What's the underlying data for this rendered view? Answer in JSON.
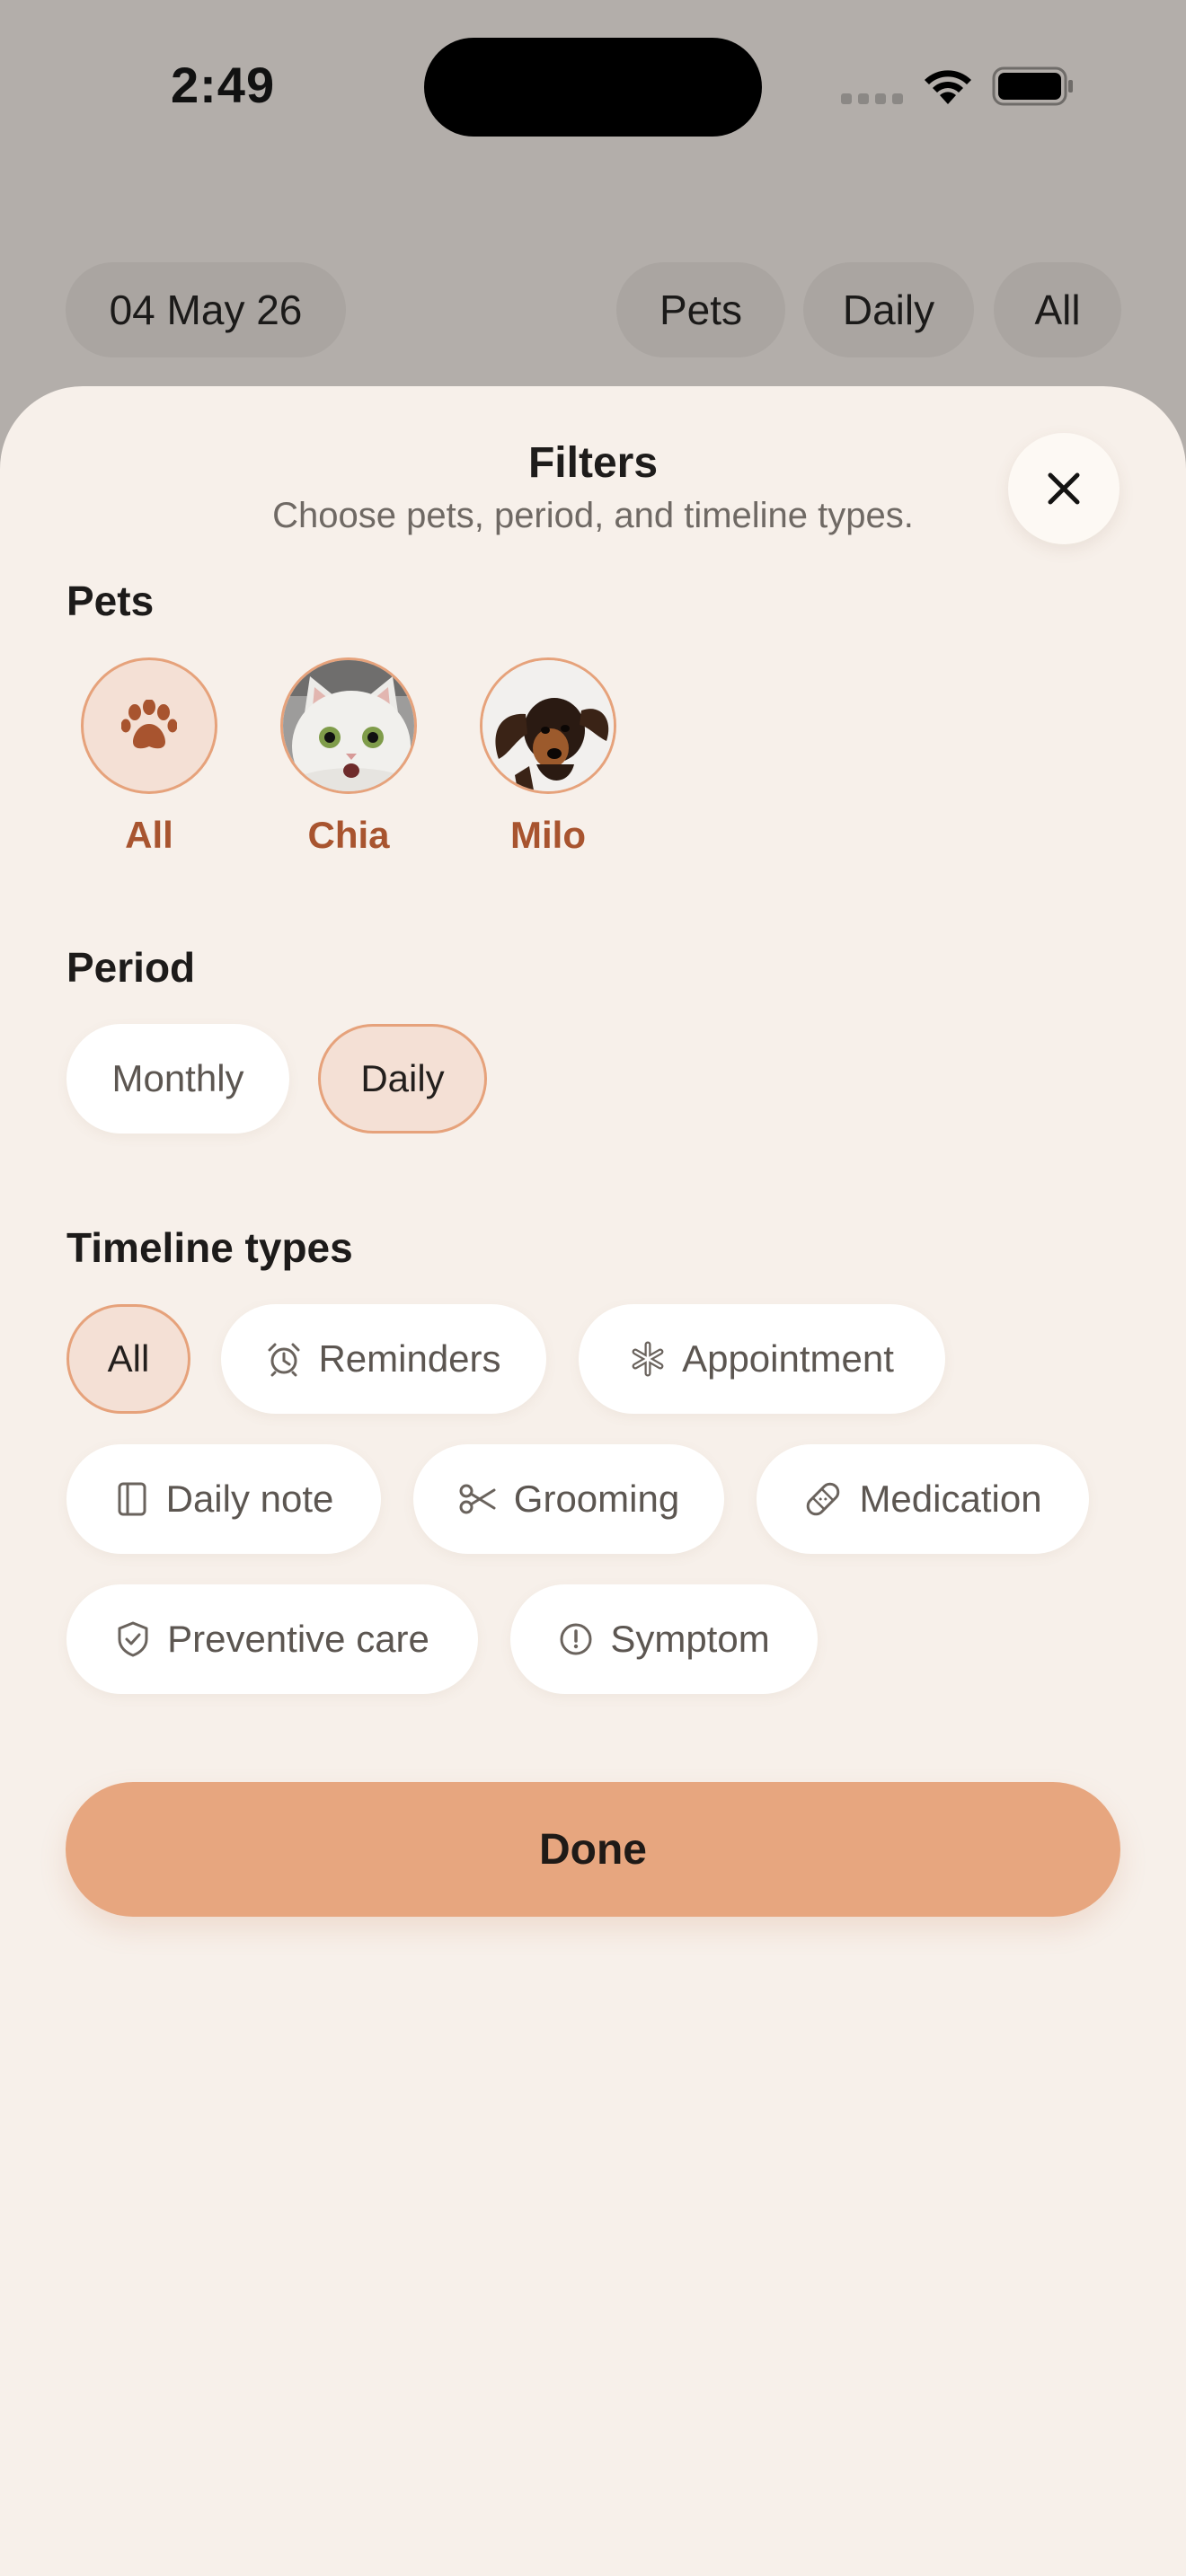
{
  "status_bar": {
    "time": "2:49"
  },
  "background_filters": {
    "date": "04 May 26",
    "pets": "Pets",
    "period": "Daily",
    "types": "All"
  },
  "sheet": {
    "title": "Filters",
    "subtitle": "Choose pets, period, and timeline types.",
    "close_icon": "close-icon"
  },
  "pets_section": {
    "label": "Pets",
    "items": [
      {
        "name": "All",
        "icon": "paw-icon",
        "selected": true
      },
      {
        "name": "Chia",
        "icon": "cat-photo",
        "selected": false
      },
      {
        "name": "Milo",
        "icon": "dog-photo",
        "selected": false
      }
    ]
  },
  "period_section": {
    "label": "Period",
    "options": [
      {
        "label": "Monthly",
        "selected": false
      },
      {
        "label": "Daily",
        "selected": true
      }
    ]
  },
  "types_section": {
    "label": "Timeline types",
    "options": [
      {
        "label": "All",
        "icon": "",
        "selected": true
      },
      {
        "label": "Reminders",
        "icon": "alarm-clock-icon",
        "selected": false
      },
      {
        "label": "Appointment",
        "icon": "medical-cross-icon",
        "selected": false
      },
      {
        "label": "Daily note",
        "icon": "notebook-icon",
        "selected": false
      },
      {
        "label": "Grooming",
        "icon": "scissors-icon",
        "selected": false
      },
      {
        "label": "Medication",
        "icon": "bandage-icon",
        "selected": false
      },
      {
        "label": "Preventive care",
        "icon": "shield-check-icon",
        "selected": false
      },
      {
        "label": "Symptom",
        "icon": "alert-circle-icon",
        "selected": false
      }
    ]
  },
  "done_button": {
    "label": "Done"
  },
  "colors": {
    "accent": "#e7a67f",
    "selected_bg": "#f4e0d5",
    "selected_border": "#e6a27b",
    "pet_name": "#a8542f",
    "sheet_bg": "#f7f0ea"
  }
}
